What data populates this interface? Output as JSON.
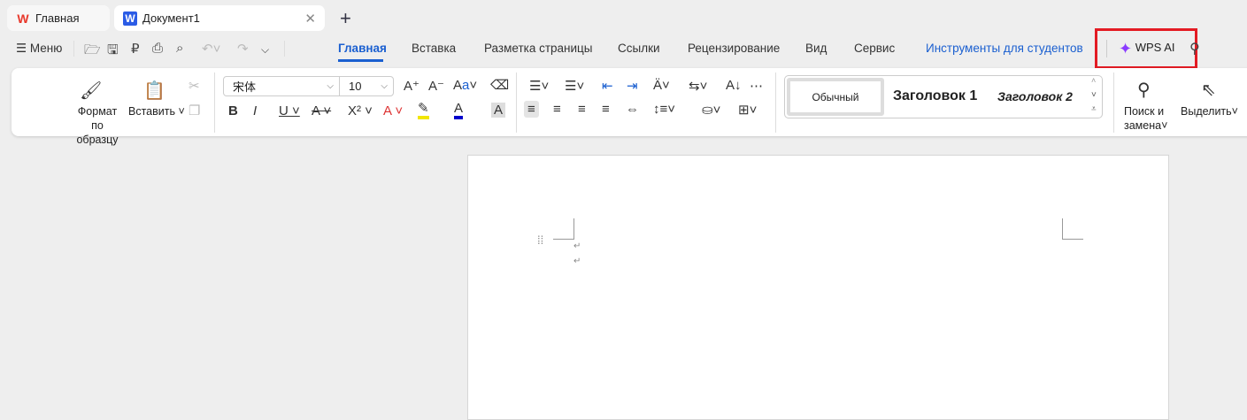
{
  "tabs": [
    {
      "label": "Главная",
      "icon": "wps-logo-icon"
    },
    {
      "label": "Документ1",
      "icon": "writer-doc-icon"
    }
  ],
  "menu_label": "Меню",
  "ribbon_tabs": [
    "Главная",
    "Вставка",
    "Разметка страницы",
    "Ссылки",
    "Рецензирование",
    "Вид",
    "Сервис",
    "Инструменты для студентов"
  ],
  "wps_ai": "WPS AI",
  "ribbon": {
    "format_painter": [
      "Формат",
      "по образцу"
    ],
    "paste": "Вставить",
    "font_name": "宋体",
    "font_size": "10",
    "styles": [
      "Обычный",
      "Заголовок 1",
      "Заголовок 2"
    ],
    "find_replace": [
      "Поиск и",
      "замена"
    ],
    "select": "Выделить"
  },
  "colors": {
    "accent": "#1a5fd0",
    "highlight": "#f2e600",
    "font_color": "#0000cc",
    "red_box": "#e31b23"
  }
}
